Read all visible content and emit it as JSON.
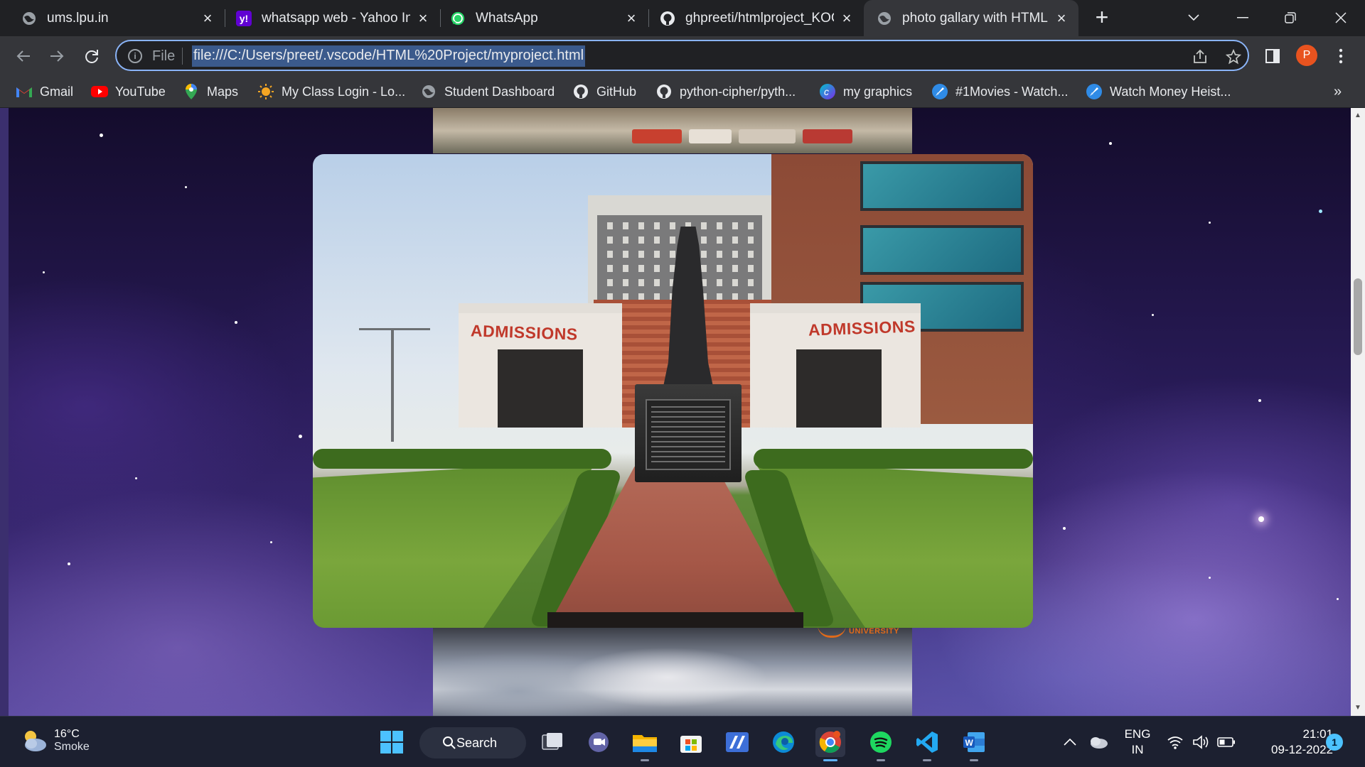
{
  "tabs": [
    {
      "title": "ums.lpu.in",
      "icon": "globe-icon"
    },
    {
      "title": "whatsapp web - Yahoo Ind",
      "icon": "yahoo-icon"
    },
    {
      "title": "WhatsApp",
      "icon": "whatsapp-icon"
    },
    {
      "title": "ghpreeti/htmlproject_KOC",
      "icon": "github-icon"
    },
    {
      "title": "photo gallary with HTML",
      "icon": "globe-icon",
      "active": true
    }
  ],
  "omnibox": {
    "scheme_label": "File",
    "url": "file:///C:/Users/preet/.vscode/HTML%20Project/myproject.html"
  },
  "profile": {
    "initial": "P",
    "color": "#e8531f"
  },
  "bookmarks": [
    {
      "label": "Gmail",
      "icon": "gmail-icon"
    },
    {
      "label": "YouTube",
      "icon": "youtube-icon"
    },
    {
      "label": "Maps",
      "icon": "maps-icon"
    },
    {
      "label": "My Class Login - Lo...",
      "icon": "sun-icon"
    },
    {
      "label": "Student Dashboard",
      "icon": "globe-icon"
    },
    {
      "label": "GitHub",
      "icon": "github-icon"
    },
    {
      "label": "python-cipher/pyth...",
      "icon": "github-icon"
    },
    {
      "label": "my graphics",
      "icon": "canva-icon"
    },
    {
      "label": "#1Movies - Watch...",
      "icon": "rocket-icon"
    },
    {
      "label": "Watch Money Heist...",
      "icon": "rocket-icon"
    }
  ],
  "page": {
    "photo_signs": {
      "left": "ADMISSIONS",
      "right": "ADMISSIONS"
    },
    "strip_logo_text": "UNIVERSITY"
  },
  "taskbar": {
    "weather": {
      "temp": "16°C",
      "condition": "Smoke"
    },
    "search_label": "Search",
    "language": {
      "line1": "ENG",
      "line2": "IN"
    },
    "time": "21:01",
    "date": "09-12-2022",
    "notification_count": "1"
  }
}
